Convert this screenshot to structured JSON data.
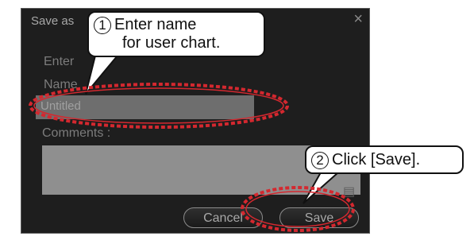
{
  "dialog": {
    "title": "Save as",
    "close_glyph": "×",
    "enter_label": "Enter",
    "name_label": "Name",
    "name_value": "Untitled",
    "comments_label": "Comments :",
    "keyboard_icon": "keyboard-icon",
    "cancel_label": "Cancel",
    "save_label": "Save"
  },
  "callouts": {
    "step1": {
      "number": "1",
      "line1": "Enter name",
      "line2": "for user chart."
    },
    "step2": {
      "number": "2",
      "text": "Click [Save]."
    }
  },
  "colors": {
    "dialog_bg": "#1e1e1e",
    "highlight": "#d4282f"
  }
}
